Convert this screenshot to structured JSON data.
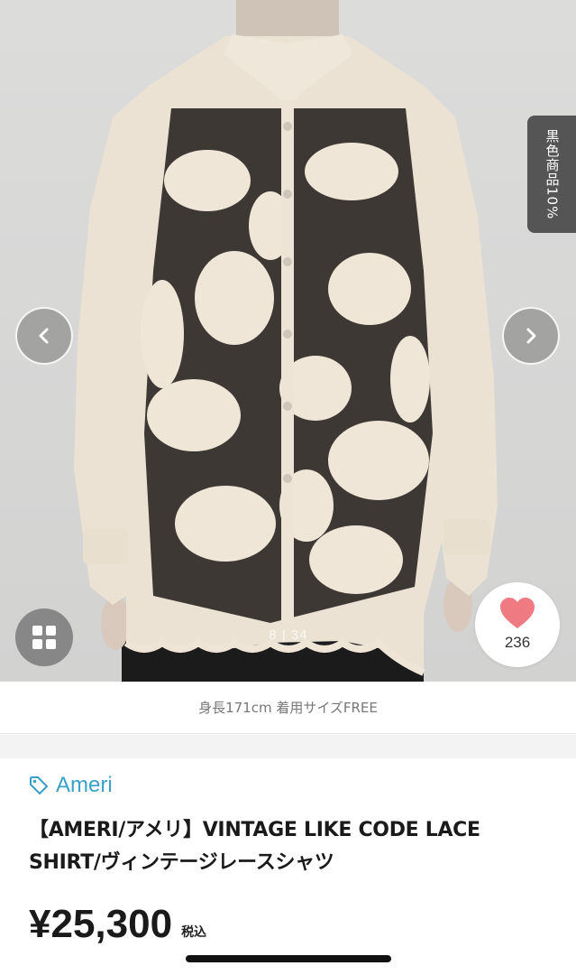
{
  "gallery": {
    "counter_current": "8",
    "counter_total": "34",
    "counter_text": "8 | 34",
    "side_tag_text": "黒色商品10%",
    "prev_icon": "chevron-left-icon",
    "next_icon": "chevron-right-icon",
    "grid_icon": "grid-icon"
  },
  "like": {
    "icon": "heart-icon",
    "count": "236",
    "color": "#f07a82"
  },
  "caption": "身長171cm 着用サイズFREE",
  "product": {
    "brand_icon": "tag-icon",
    "brand": "Ameri",
    "brand_color": "#3aa0c8",
    "title": "【AMERI/アメリ】VINTAGE LIKE CODE LACE SHIRT/ヴィンテージレースシャツ",
    "price": "¥25,300",
    "tax_label": "税込"
  }
}
